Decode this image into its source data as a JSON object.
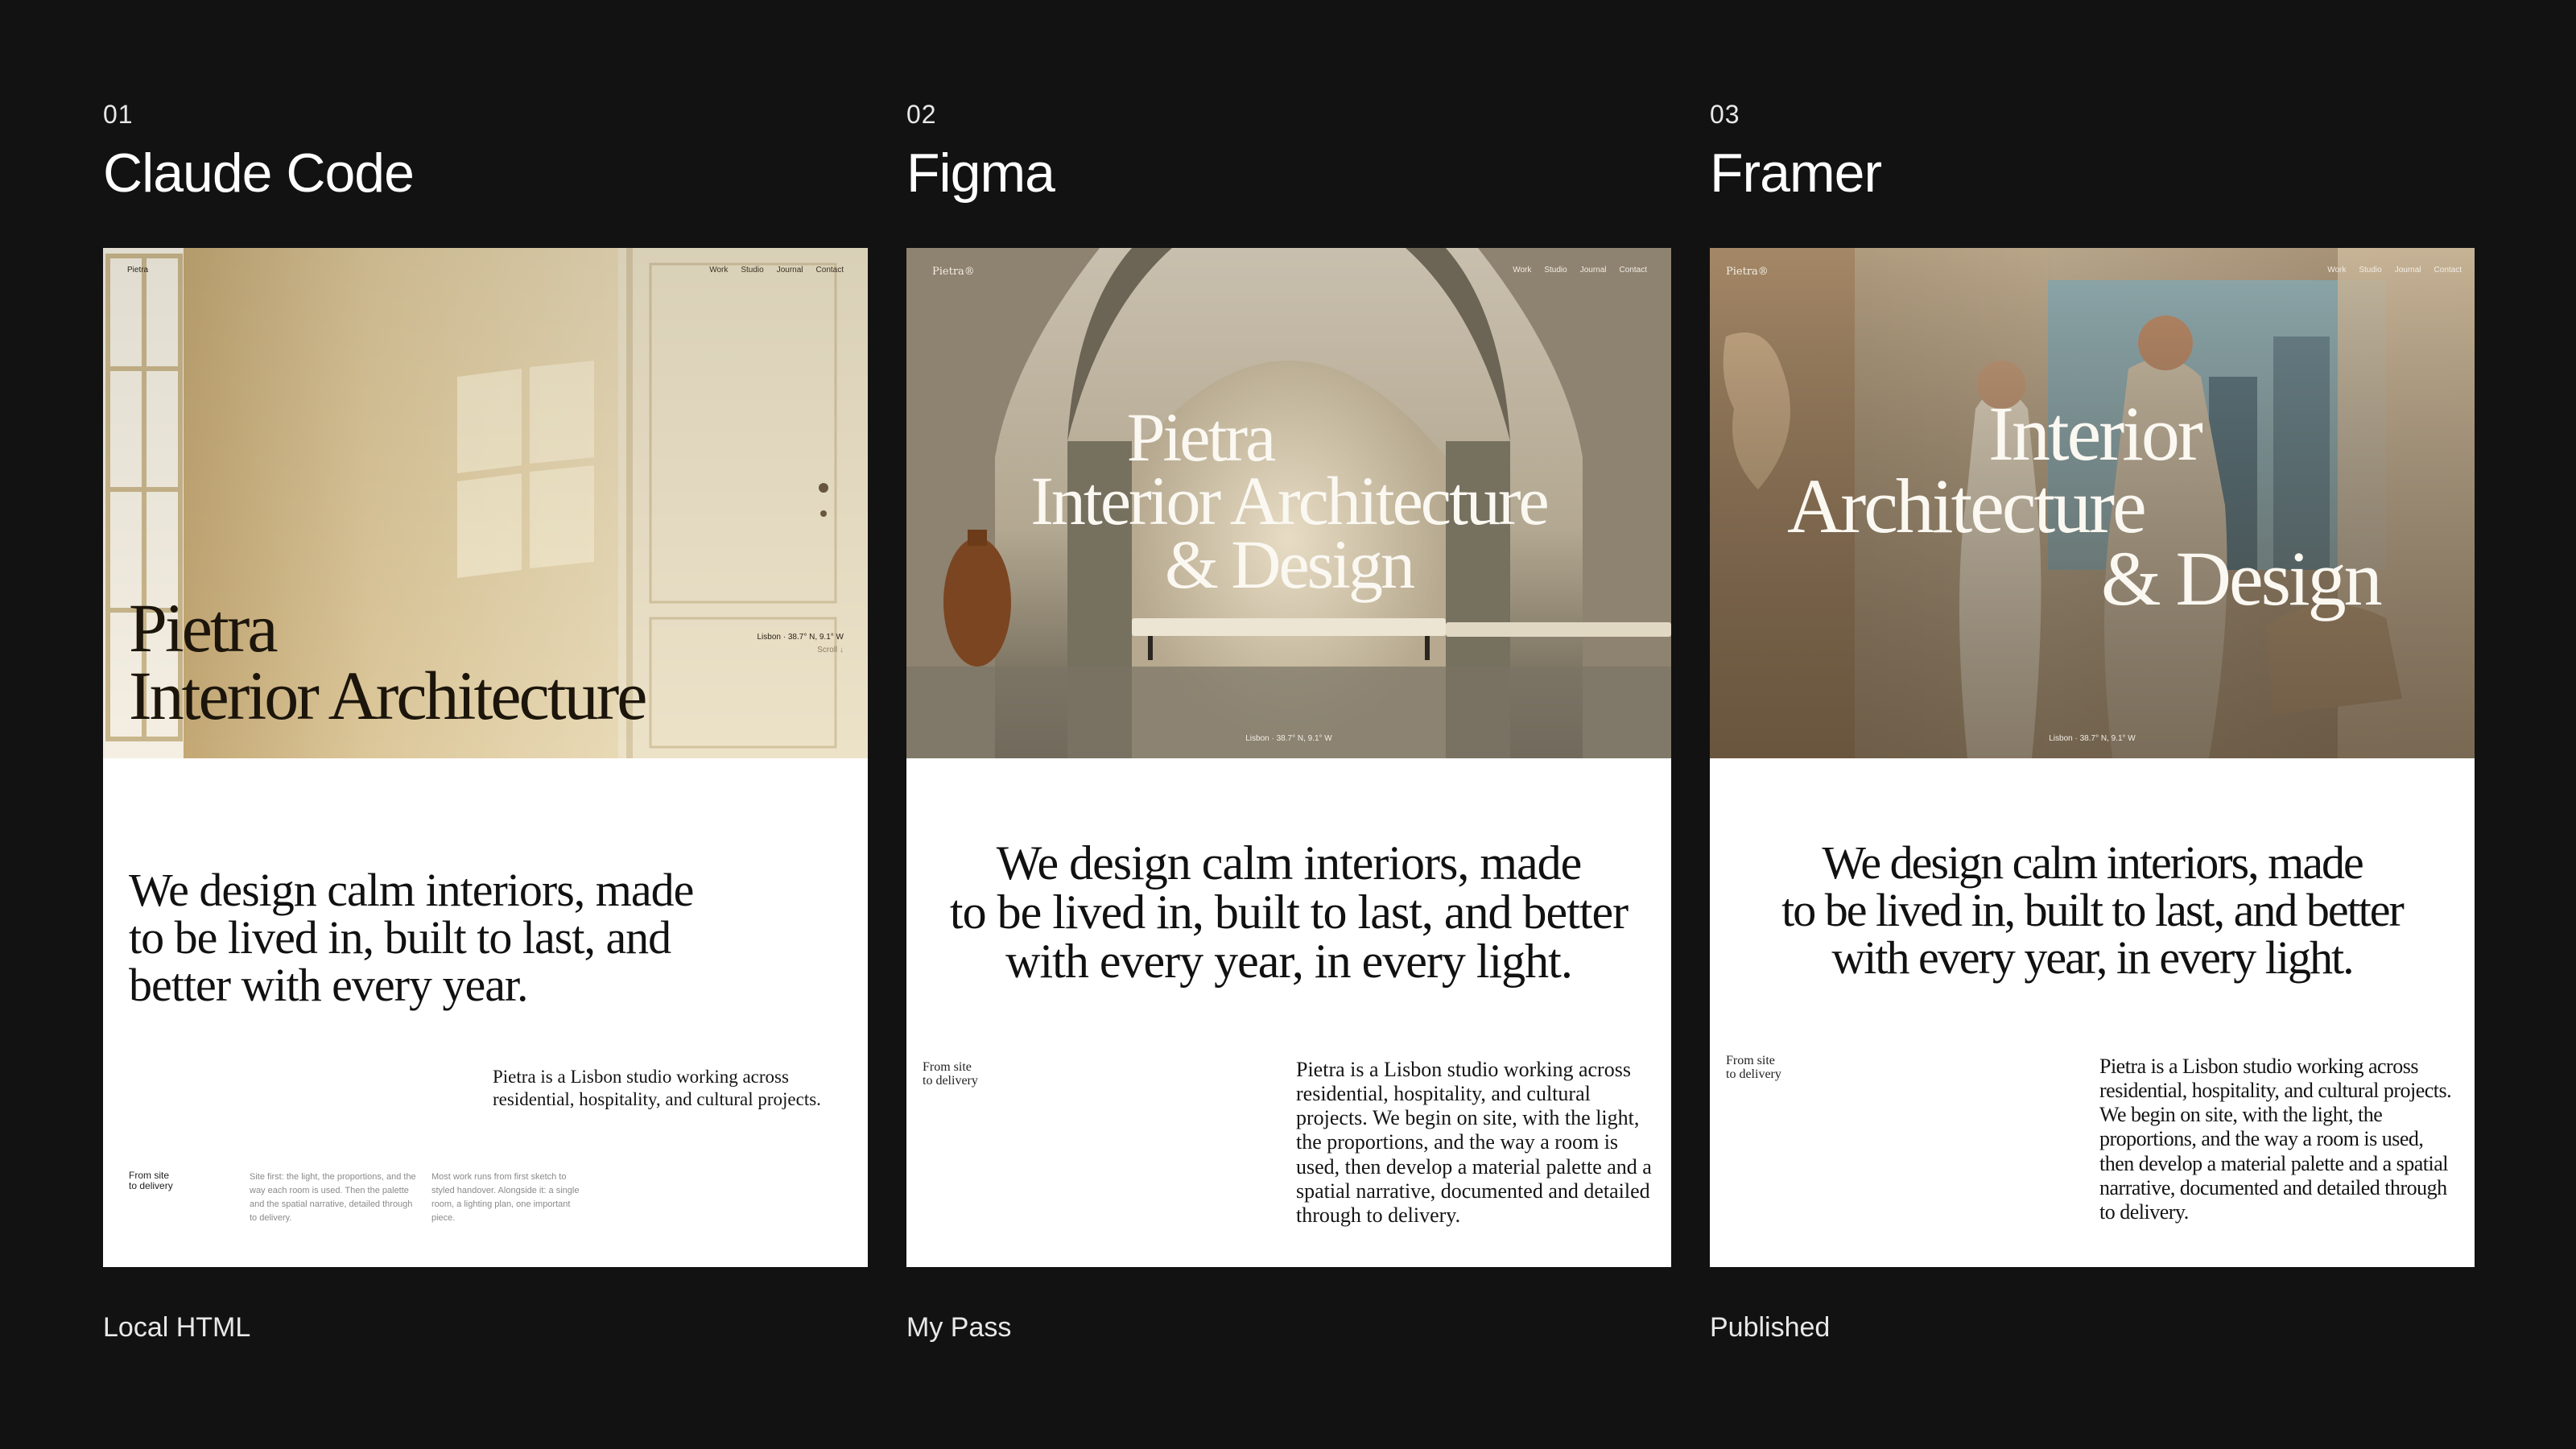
{
  "colors": {
    "background": "#121212",
    "card": "#ffffff",
    "ink": "#111111"
  },
  "panels": [
    {
      "number": "01",
      "tool": "Claude Code",
      "caption": "Local HTML",
      "brand": "Pietra",
      "nav": [
        "Work",
        "Studio",
        "Journal",
        "Contact"
      ],
      "hero_lines": [
        "Pietra",
        "Interior Architecture"
      ],
      "coords": "Lisbon · 38.7° N, 9.1° W",
      "scroll": "Scroll ↓",
      "lead_lines": [
        "We design calm interiors, made",
        "to be lived in, built to last, and",
        "better with every year."
      ],
      "body": "Pietra is a Lisbon studio working across residential, hospitality, and cultural projects.",
      "label_lines": [
        "From site",
        "to delivery"
      ],
      "note1": "Site first: the light, the proportions, and the way each room is used. Then the palette and the spatial narrative, detailed through to delivery.",
      "note2": "Most work runs from first sketch to styled handover. Alongside it: a single room, a lighting plan, one important piece."
    },
    {
      "number": "02",
      "tool": "Figma",
      "caption": "My Pass",
      "brand": "Pietra®",
      "nav": [
        "Work",
        "Studio",
        "Journal",
        "Contact"
      ],
      "hero_lines": [
        "Pietra",
        "Interior Architecture",
        "& Design"
      ],
      "coords": "Lisbon · 38.7° N, 9.1° W",
      "lead_lines": [
        "We design calm interiors, made",
        "to be lived in, built to last, and better",
        "with every year, in every light."
      ],
      "label_lines": [
        "From site",
        "to delivery"
      ],
      "body": "Pietra is a Lisbon studio working across residential, hospitality, and cultural projects. We begin on site, with the light, the proportions, and the way a room is used, then develop a material palette and a spatial narrative, documented and detailed through to delivery."
    },
    {
      "number": "03",
      "tool": "Framer",
      "caption": "Published",
      "brand": "Pietra®",
      "nav": [
        "Work",
        "Studio",
        "Journal",
        "Contact"
      ],
      "hero_lines": [
        "Interior",
        "Architecture",
        "& Design"
      ],
      "coords": "Lisbon · 38.7° N, 9.1° W",
      "lead_lines": [
        "We design calm interiors, made",
        "to be lived in, built to last, and better",
        "with every year, in every light."
      ],
      "label_lines": [
        "From site",
        "to delivery"
      ],
      "body": "Pietra is a Lisbon studio working across residential, hospitality, and cultural projects. We begin on site, with the light, the proportions, and the way a room is used, then develop a material palette and a spatial narrative, documented and detailed through to delivery."
    }
  ]
}
